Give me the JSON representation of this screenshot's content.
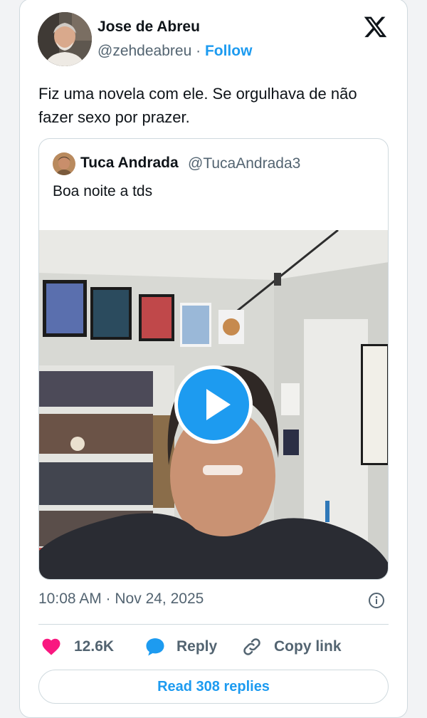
{
  "author": {
    "name": "Jose de Abreu",
    "handle": "@zehdeabreu",
    "separator": "·",
    "follow_label": "Follow"
  },
  "tweet": {
    "text": "Fiz uma novela com ele. Se orgulhava de não fazer sexo por prazer."
  },
  "quoted_tweet": {
    "name": "Tuca Andrada",
    "handle": "@TucaAndrada3",
    "text": "Boa noite a tds",
    "media": "video"
  },
  "meta": {
    "timestamp": "10:08 AM · Nov 24, 2025"
  },
  "actions": {
    "like_count": "12.6K",
    "reply_label": "Reply",
    "copy_link_label": "Copy link",
    "read_replies_label": "Read 308 replies"
  },
  "icons": {
    "logo": "x-logo-icon",
    "like": "heart-icon",
    "reply": "speech-bubble-icon",
    "copy": "link-icon",
    "info": "info-icon",
    "play": "play-icon"
  },
  "colors": {
    "accent": "#1d9bf0",
    "like": "#f91880",
    "text": "#0f1419",
    "secondary": "#536471",
    "border": "#cfd9de"
  }
}
